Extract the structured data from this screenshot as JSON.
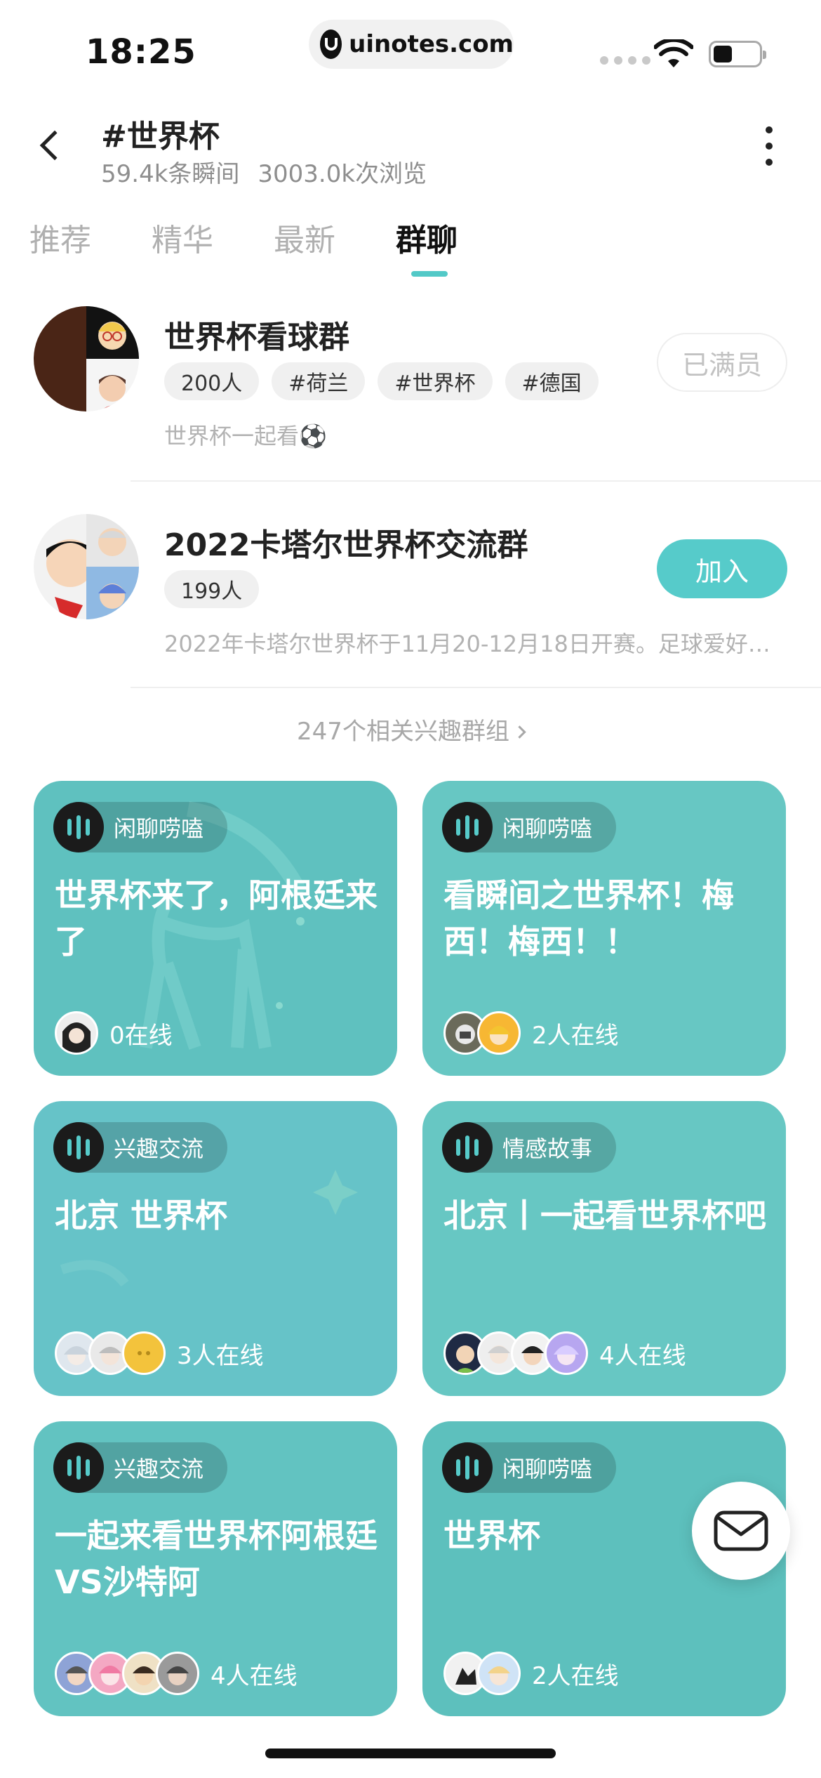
{
  "status_bar": {
    "time": "18:25",
    "url": "uinotes.com"
  },
  "header": {
    "title": "#世界杯",
    "moments": "59.4k条瞬间",
    "views": "3003.0k次浏览"
  },
  "tabs": [
    {
      "label": "推荐",
      "active": false
    },
    {
      "label": "精华",
      "active": false
    },
    {
      "label": "最新",
      "active": false
    },
    {
      "label": "群聊",
      "active": true
    }
  ],
  "groups": [
    {
      "name": "世界杯看球群",
      "tags": [
        "200人",
        "#荷兰",
        "#世界杯",
        "#德国"
      ],
      "description": "世界杯一起看⚽",
      "action": "已满员"
    },
    {
      "name": "2022卡塔尔世界杯交流群",
      "tags": [
        "199人"
      ],
      "description": "2022年卡塔尔世界杯于11月20-12月18日开赛。足球爱好…",
      "action": "加入"
    }
  ],
  "related_link": "247个相关兴趣群组",
  "rooms": [
    {
      "category": "闲聊唠嗑",
      "title": "世界杯来了，阿根廷来了",
      "online": "0在线",
      "avatar_count": 1
    },
    {
      "category": "闲聊唠嗑",
      "title": "看瞬间之世界杯！梅西！梅西！！",
      "online": "2人在线",
      "avatar_count": 2
    },
    {
      "category": "兴趣交流",
      "title": "北京 世界杯",
      "online": "3人在线",
      "avatar_count": 3
    },
    {
      "category": "情感故事",
      "title": "北京丨一起看世界杯吧",
      "online": "4人在线",
      "avatar_count": 4
    },
    {
      "category": "兴趣交流",
      "title": "一起来看世界杯阿根廷VS沙特阿",
      "online": "4人在线",
      "avatar_count": 4
    },
    {
      "category": "闲聊唠嗑",
      "title": "世界杯",
      "online": "2人在线",
      "avatar_count": 2
    }
  ],
  "colors": {
    "accent": "#56cbca",
    "card": "#63c5c2",
    "text_primary": "#222222",
    "text_muted": "#8e8e8e"
  },
  "icons": {
    "back": "chevron-left-icon",
    "more": "more-vertical-icon",
    "message": "envelope-icon",
    "room": "audio-bars-icon"
  }
}
